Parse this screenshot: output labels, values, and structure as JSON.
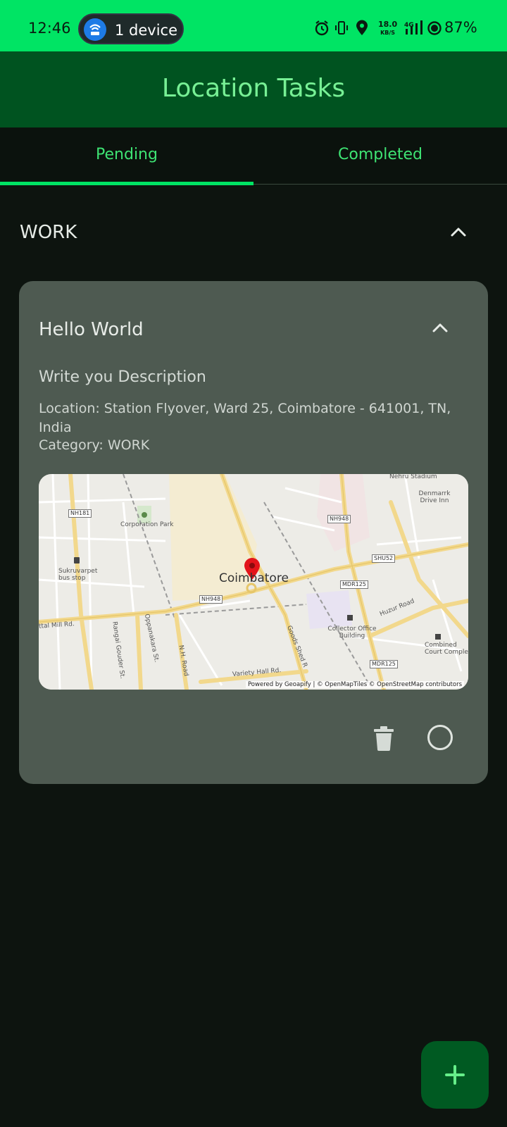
{
  "status_bar": {
    "time": "12:46",
    "device_pill": "1 device",
    "net_speed": "18.0",
    "net_unit": "KB/S",
    "network": "4G",
    "battery": "87%"
  },
  "app_bar": {
    "title": "Location Tasks"
  },
  "tabs": [
    {
      "label": "Pending",
      "selected": true
    },
    {
      "label": "Completed",
      "selected": false
    }
  ],
  "section": {
    "title": "WORK",
    "expanded": true
  },
  "task": {
    "title": "Hello World",
    "description": "Write you Description",
    "location": "Location: Station Flyover, Ward 25, Coimbatore - 641001, TN, India",
    "category": "Category: WORK",
    "map": {
      "city": "Coimbatore",
      "attribution": "Powered by Geoapify | © OpenMapTiles © OpenStreetMap contributors",
      "labels": {
        "nehru": "Nehru Stadium",
        "denmarrk": "Denmarrk Drive Inn",
        "corporation_park": "Corporation Park",
        "sukruvarpet": "Sukruvarpet bus stop",
        "collector": "Collector Office Building",
        "combined": "Combined Court Complex",
        "huzur": "Huzur Road",
        "variety": "Variety Hall Rd.",
        "mill": "ttal Mill Rd.",
        "rangai": "Rangai Gouder St.",
        "oppanakara": "Oppanakara St.",
        "nh_road": "N.H. Road",
        "goods": "Goods Shed R"
      },
      "shields": {
        "nh181": "NH181",
        "nh948a": "NH948",
        "nh948b": "NH948",
        "shu52": "SHU52",
        "mdr125a": "MDR125",
        "mdr125b": "MDR125"
      }
    }
  },
  "colors": {
    "accent": "#00e464",
    "app_bar": "#005320",
    "card": "#4e5a51",
    "background": "#0d140f"
  },
  "icons": {
    "section_toggle": "chevron-up-icon",
    "task_toggle": "chevron-up-icon",
    "delete": "trash-icon",
    "complete": "circle-outline-icon",
    "fab": "plus-icon"
  }
}
